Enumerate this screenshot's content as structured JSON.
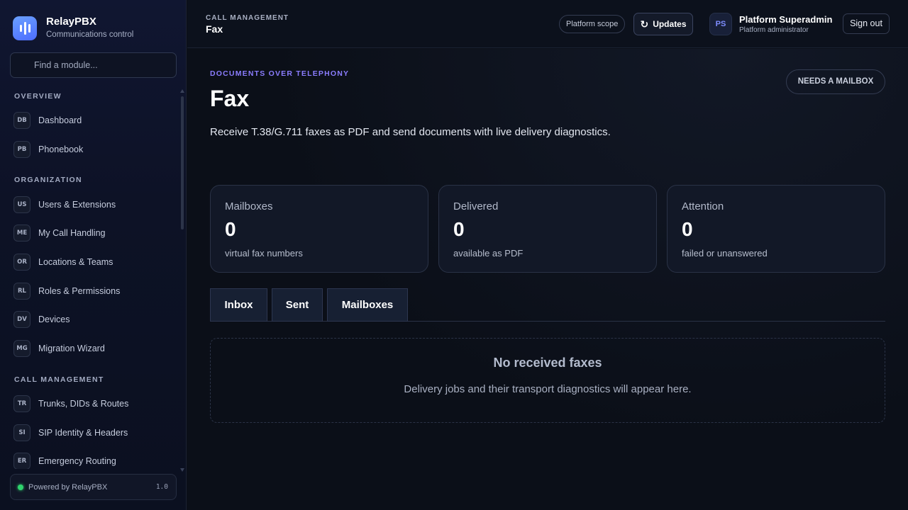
{
  "brand": {
    "name": "RelayPBX",
    "subtitle": "Communications control"
  },
  "search": {
    "placeholder": "Find a module..."
  },
  "sidebar": {
    "sections": [
      {
        "title": "OVERVIEW",
        "items": [
          {
            "badge": "DB",
            "label": "Dashboard"
          },
          {
            "badge": "PB",
            "label": "Phonebook"
          }
        ]
      },
      {
        "title": "ORGANIZATION",
        "items": [
          {
            "badge": "US",
            "label": "Users & Extensions"
          },
          {
            "badge": "ME",
            "label": "My Call Handling"
          },
          {
            "badge": "OR",
            "label": "Locations & Teams"
          },
          {
            "badge": "RL",
            "label": "Roles & Permissions"
          },
          {
            "badge": "DV",
            "label": "Devices"
          },
          {
            "badge": "MG",
            "label": "Migration Wizard"
          }
        ]
      },
      {
        "title": "CALL MANAGEMENT",
        "items": [
          {
            "badge": "TR",
            "label": "Trunks, DIDs & Routes"
          },
          {
            "badge": "SI",
            "label": "SIP Identity & Headers"
          },
          {
            "badge": "ER",
            "label": "Emergency Routing"
          }
        ]
      }
    ],
    "footer": {
      "text": "Powered by RelayPBX",
      "version": "1.0"
    }
  },
  "topbar": {
    "section": "CALL MANAGEMENT",
    "title": "Fax",
    "scope": "Platform scope",
    "updates_label": "Updates",
    "user": {
      "initials": "PS",
      "name": "Platform Superadmin",
      "role": "Platform administrator"
    },
    "signout_label": "Sign out"
  },
  "page": {
    "eyebrow": "DOCUMENTS OVER TELEPHONY",
    "title": "Fax",
    "description": "Receive T.38/G.711 faxes as PDF and send documents with live delivery diagnostics.",
    "action_label": "NEEDS A MAILBOX",
    "stats": [
      {
        "label": "Mailboxes",
        "value": "0",
        "sub": "virtual fax numbers"
      },
      {
        "label": "Delivered",
        "value": "0",
        "sub": "available as PDF"
      },
      {
        "label": "Attention",
        "value": "0",
        "sub": "failed or unanswered"
      }
    ],
    "tabs": [
      "Inbox",
      "Sent",
      "Mailboxes"
    ],
    "empty": {
      "title": "No received faxes",
      "description": "Delivery jobs and their transport diagnostics will appear here."
    }
  },
  "colors": {
    "accent": "#8b7dff",
    "status_ok": "#2fd46d",
    "brand": "#5b7dff"
  }
}
